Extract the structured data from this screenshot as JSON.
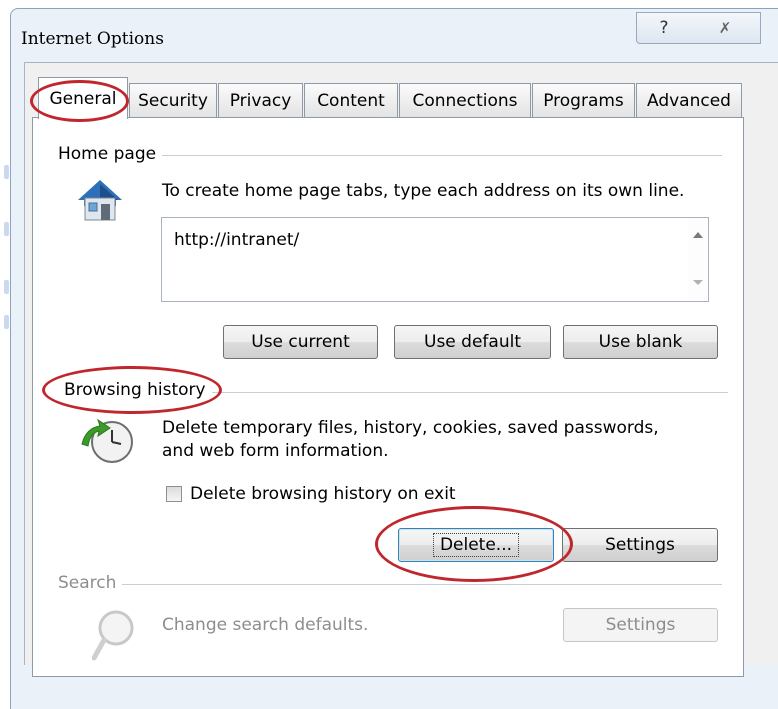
{
  "window": {
    "title": "Internet Options",
    "help_glyph": "?",
    "close_glyph": "✗"
  },
  "tabs": [
    {
      "label": "General",
      "active": true
    },
    {
      "label": "Security",
      "active": false
    },
    {
      "label": "Privacy",
      "active": false
    },
    {
      "label": "Content",
      "active": false
    },
    {
      "label": "Connections",
      "active": false
    },
    {
      "label": "Programs",
      "active": false
    },
    {
      "label": "Advanced",
      "active": false
    }
  ],
  "home_page": {
    "group_label": "Home page",
    "instructions": "To create home page tabs, type each address on its own line.",
    "url_value": "http://intranet/",
    "buttons": {
      "use_current": "Use current",
      "use_default": "Use default",
      "use_blank": "Use blank"
    },
    "icon": "house-icon"
  },
  "browsing_history": {
    "group_label": "Browsing history",
    "description_line1": "Delete temporary files, history, cookies, saved passwords,",
    "description_line2": "and web form information.",
    "checkbox_label": "Delete browsing history on exit",
    "checkbox_checked": false,
    "delete_button": "Delete...",
    "settings_button": "Settings",
    "icon": "history-clock-icon"
  },
  "search": {
    "group_label": "Search",
    "description": "Change search defaults.",
    "settings_button": "Settings",
    "enabled": false,
    "icon": "magnifier-icon"
  },
  "annotation_color": "#c0272d"
}
